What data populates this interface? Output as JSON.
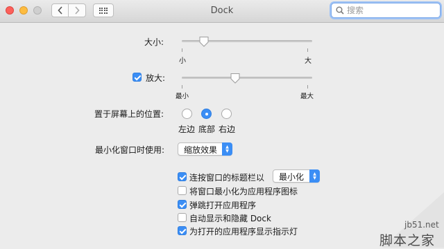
{
  "window": {
    "title": "Dock"
  },
  "search": {
    "placeholder": "搜索"
  },
  "size": {
    "label": "大小:",
    "min_label": "小",
    "max_label": "大",
    "value": 0.17
  },
  "magnification": {
    "label": "放大:",
    "checked": true,
    "min_label": "最小",
    "max_label": "最大",
    "value": 0.41
  },
  "position": {
    "label": "置于屏幕上的位置:",
    "options": [
      {
        "label": "左边",
        "selected": false
      },
      {
        "label": "底部",
        "selected": true
      },
      {
        "label": "右边",
        "selected": false
      }
    ]
  },
  "minimize": {
    "label": "最小化窗口时使用:",
    "value": "缩放效果"
  },
  "options": [
    {
      "label": "连按窗口的标题栏以",
      "checked": true
    },
    {
      "label": "将窗口最小化为应用程序图标",
      "checked": false
    },
    {
      "label": "弹跳打开应用程序",
      "checked": true
    },
    {
      "label": "自动显示和隐藏 Dock",
      "checked": false
    },
    {
      "label": "为打开的应用程序显示指示灯",
      "checked": true
    }
  ],
  "double_click_action": {
    "value": "最小化"
  },
  "watermark": {
    "line1": "jb51.net",
    "line2": "脚本之家"
  },
  "colors": {
    "accent": "#3b8ef5",
    "background": "#ececec"
  }
}
